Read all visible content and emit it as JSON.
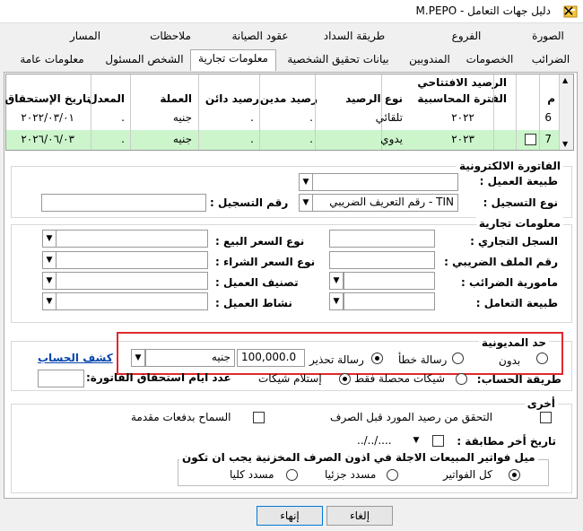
{
  "window": {
    "title": "دليل جهات التعامل - M.PEPO"
  },
  "tabs_row1": [
    "الصورة",
    "الفروع",
    "طريقة السداد",
    "عقود الصيانة",
    "ملاحظات",
    "المسار"
  ],
  "tabs_row2": [
    "الضرائب",
    "الخصومات",
    "المندوبين",
    "بيانات تحقيق الشخصية",
    "معلومات تجارية",
    "الشخص المسئول",
    "معلومات عامة"
  ],
  "grid": {
    "headers": {
      "m": "م",
      "period": "الفترة المحاسبية",
      "opening": "الرصيد الافتتاحي",
      "balance_type": "نوع الرصيد",
      "debit": "رصيد مدين",
      "credit": "رصيد دائن",
      "currency": "العملة",
      "rate": "المعدل",
      "due_date": "تاريخ الإستحقاق"
    },
    "rows": [
      {
        "m": "6",
        "period": "٢٠٢٢",
        "balance_type": "تلقائي",
        "debit": ".",
        "credit": ".",
        "currency": "جنيه",
        "rate": ".",
        "due_date": "٢٠٢٢/٠٣/٠١"
      },
      {
        "m": "7",
        "period": "٢٠٢٣",
        "balance_type": "يدوي",
        "debit": ".",
        "credit": ".",
        "currency": "جنيه",
        "rate": ".",
        "due_date": "٢٠٢٦/٠٦/٠٣"
      }
    ]
  },
  "einvoice": {
    "heading": "الفاتورة الالكترونية",
    "customer_nature_label": "طبيعة العميل :",
    "customer_nature_value": "",
    "reg_type_label": "نوع التسجيل :",
    "reg_type_value": "TIN - رقم التعريف الضريبي",
    "reg_number_label": "رقم التسجيل :",
    "reg_number_value": ""
  },
  "commercial": {
    "heading": "معلومات تجارية",
    "commercial_register": "السجل التجاري :",
    "tax_file": "رقم الملف الضريبي :",
    "tax_office": "مامورية الضرائب :",
    "dealing_nature": "طبيعة التعامل :",
    "sale_price_type": "نوع السعر البيع :",
    "purchase_price_type": "نوع السعر الشراء :",
    "customer_class": "تصنيف العميل :",
    "customer_activity": "نشاط العميل :"
  },
  "debt_limit": {
    "heading": "حد المديونية",
    "option_none": "بدون",
    "option_error": "رسالة خطأ",
    "option_warning": "رسالة تحذير",
    "amount": "100,000.0",
    "currency": "جنيه",
    "selected": "warning"
  },
  "account": {
    "statement_link": "كشف الحساب",
    "method_label": "طريقة الحساب:",
    "method_collected": "شيكات محصلة فقط",
    "method_received": "إستلام شيكات",
    "due_days_label": "عدد ايام استحقاق الفاتورة:",
    "due_days_value": ""
  },
  "other": {
    "heading": "أخرى",
    "verify_balance": "التحقق من رصيد المورد قبل الصرف",
    "allow_advance": "السماح بدفعات مقدمة",
    "last_match_label": "تاريخ أخر مطابقة :",
    "last_match_value": "..../../..",
    "deferred_heading": "ميل فواتير المبيعات الاجلة في اذون الصرف المخزنية يجب ان تكون",
    "opt_all": "كل الفواتير",
    "opt_partial": "مسدد جزئيا",
    "opt_full": "مسدد كليا",
    "selected": "all"
  },
  "buttons": {
    "cancel": "إلغاء",
    "finish": "إنهاء"
  }
}
